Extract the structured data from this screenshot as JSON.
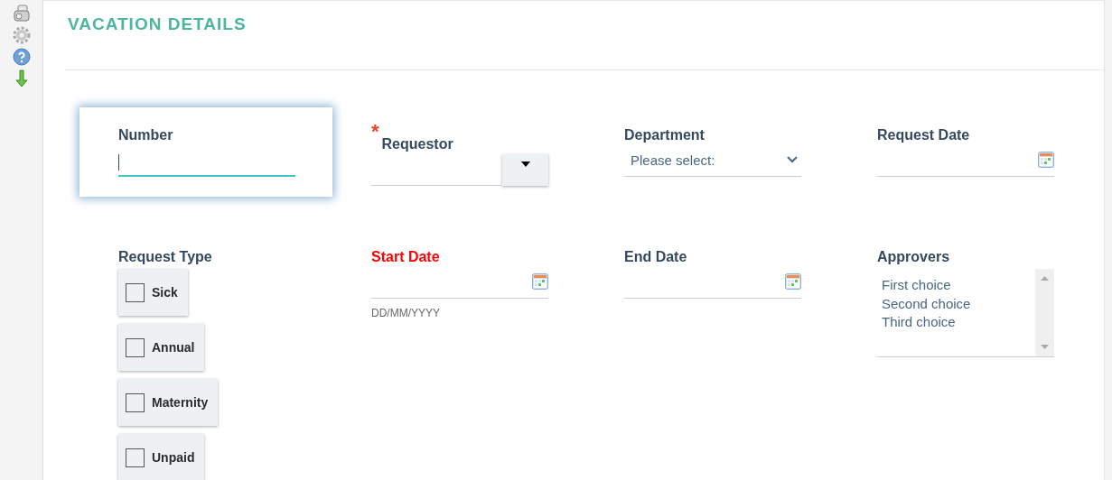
{
  "toolbar": {
    "items": [
      {
        "kind": "print"
      },
      {
        "kind": "settings"
      },
      {
        "kind": "help"
      },
      {
        "kind": "download"
      }
    ]
  },
  "title": "VACATION DETAILS",
  "fields": [
    {
      "kind": "text",
      "label": "Number",
      "required": false,
      "error": false,
      "focused": true
    },
    {
      "kind": "combo",
      "label": "Requestor",
      "required_mark": "*",
      "required": true,
      "error": false,
      "focused": false
    },
    {
      "kind": "select",
      "label": "Department",
      "placeholder": "Please select:",
      "required": false,
      "error": false,
      "focused": false
    },
    {
      "kind": "date",
      "label": "Request Date",
      "required": false,
      "error": false,
      "focused": false
    },
    {
      "kind": "checkgroup",
      "label": "Request Type",
      "required": false,
      "error": false,
      "focused": false,
      "options": [
        {
          "label": "Sick",
          "checked": false
        },
        {
          "label": "Annual",
          "checked": false
        },
        {
          "label": "Maternity",
          "checked": false
        },
        {
          "label": "Unpaid",
          "checked": false
        }
      ]
    },
    {
      "kind": "date",
      "label": "Start Date",
      "hint": "DD/MM/YYYY",
      "required": false,
      "error": true,
      "focused": false
    },
    {
      "kind": "date",
      "label": "End Date",
      "required": false,
      "error": false,
      "focused": false
    },
    {
      "kind": "listbox",
      "label": "Approvers",
      "required": false,
      "error": false,
      "focused": false,
      "items": [
        "First choice",
        "Second choice",
        "Third choice"
      ]
    }
  ]
}
